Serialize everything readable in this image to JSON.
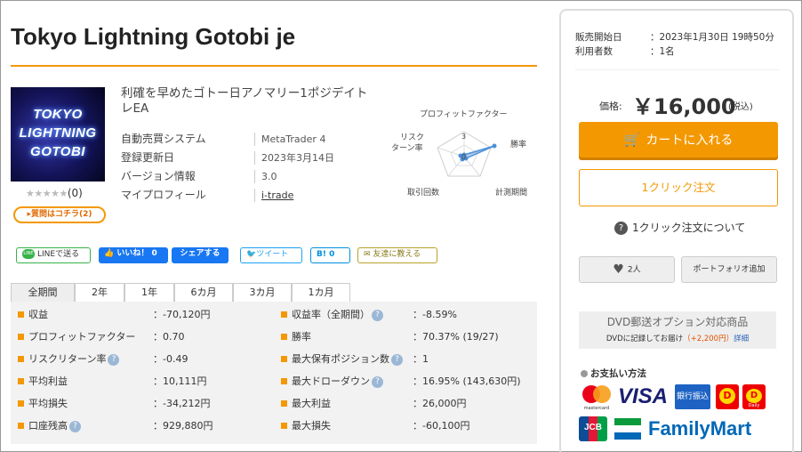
{
  "product": {
    "title": "Tokyo Lightning Gotobi je",
    "description": "利確を早めたゴトー日アノマリー1ポジデイトレEA",
    "thumbnail": {
      "lines": [
        "TOKYO",
        "LIGHTNING",
        "GOTOBI"
      ]
    },
    "rating_stars": "★★★★★",
    "rating_count": "(0)",
    "question_button": "▸質問はコチラ(2)"
  },
  "info": [
    {
      "label": "自動売買システム",
      "value": "MetaTrader 4"
    },
    {
      "label": "登録更新日",
      "value": "2023年3月14日"
    },
    {
      "label": "バージョン情報",
      "value": "3.0"
    },
    {
      "label": "マイプロフィール",
      "value": "i-trade"
    }
  ],
  "radar": {
    "labels": {
      "top": "プロフィットファクター",
      "right": "勝率",
      "bottom_right": "計測期間",
      "bottom_left": "取引回数",
      "left": "リスク\nターン率"
    },
    "scale_labels": [
      "3",
      "0"
    ],
    "accent": "#4a90d9"
  },
  "social": {
    "line": "LINEで送る",
    "line_logo": "LINE",
    "like": "いいね！ 0",
    "share": "シェアする",
    "tweet": "ツイート",
    "hatena": "B! 0",
    "friend": "友達に教える"
  },
  "tabs": [
    "全期間",
    "2年",
    "1年",
    "6カ月",
    "3カ月",
    "1カ月"
  ],
  "stats_left": [
    {
      "label": "収益",
      "value": "：-70,120円",
      "help": false
    },
    {
      "label": "プロフィットファクター",
      "value": "：0.70",
      "help": false
    },
    {
      "label": "リスクリターン率",
      "value": "：-0.49",
      "help": true
    },
    {
      "label": "平均利益",
      "value": "：10,111円",
      "help": false
    },
    {
      "label": "平均損失",
      "value": "：-34,212円",
      "help": false
    },
    {
      "label": "口座残高",
      "value": "：929,880円",
      "help": true
    }
  ],
  "stats_right": [
    {
      "label": "収益率（全期間）",
      "value": "：-8.59%",
      "help": true
    },
    {
      "label": "勝率",
      "value": "：70.37% (19/27)",
      "help": false
    },
    {
      "label": "最大保有ポジション数",
      "value": "：1",
      "help": true
    },
    {
      "label": "最大ドローダウン",
      "value": "：16.95% (143,630円)",
      "help": true
    },
    {
      "label": "最大利益",
      "value": "：26,000円",
      "help": false
    },
    {
      "label": "最大損失",
      "value": "：-60,100円",
      "help": false
    }
  ],
  "sidebar": {
    "release_label": "販売開始日",
    "release_value": "：2023年1月30日 19時50分",
    "users_label": "利用者数",
    "users_value": "：1名",
    "price_label": "価格:",
    "price": "￥16,000",
    "price_tax": "(税込)",
    "cart_button": "カートに入れる",
    "oneclick_button": "1クリック注文",
    "oneclick_about": "1クリック注文について",
    "favorite": "2人",
    "portfolio": "ポートフォリオ追加",
    "dvd_title": "DVD郵送オプション対応商品",
    "dvd_note": "DVDに記録してお届け",
    "dvd_price": "（+2,200円）",
    "dvd_link": "詳細",
    "payment_heading": "お支払い方法",
    "payment_logos": {
      "mastercard": "mastercard",
      "visa": "VISA",
      "bank": "銀行振込",
      "familymart": "FamilyMart",
      "jcb": "JCB",
      "dpay": "D",
      "dpay_small": "Daily"
    }
  },
  "colors": {
    "accent": "#f39800",
    "link": "#2a62b8",
    "facebook": "#1877f2",
    "twitter": "#1da1f2",
    "line": "#37b34a"
  }
}
